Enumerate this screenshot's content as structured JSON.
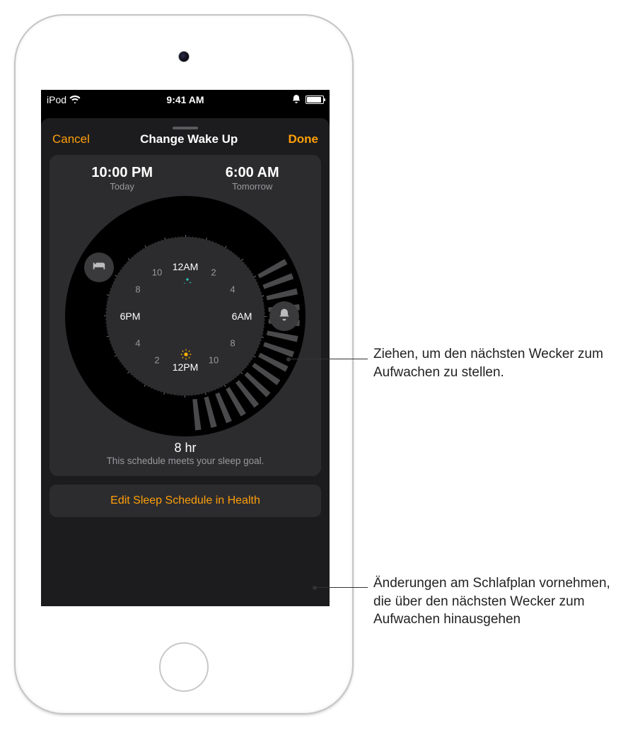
{
  "statusbar": {
    "carrier": "iPod",
    "time": "9:41 AM"
  },
  "sheet": {
    "cancel": "Cancel",
    "title": "Change Wake Up",
    "done": "Done"
  },
  "bedtime": {
    "time": "10:00 PM",
    "day": "Today"
  },
  "wake": {
    "time": "6:00 AM",
    "day": "Tomorrow"
  },
  "dial": {
    "labels": {
      "h0": "12AM",
      "h1": "2",
      "h2": "4",
      "h3": "6AM",
      "h4": "8",
      "h5": "10",
      "h6": "12PM",
      "h7": "2",
      "h8": "4",
      "h9": "6PM",
      "h10": "8",
      "h11": "10"
    }
  },
  "duration": {
    "value": "8 hr",
    "sub": "This schedule meets your sleep goal."
  },
  "edit_label": "Edit Sleep Schedule in Health",
  "callouts": {
    "wake": "Ziehen, um den nächsten Wecker zum Aufwachen zu stellen.",
    "edit": "Änderungen am Schlafplan vornehmen, die über den nächsten Wecker zum Aufwachen hinausgehen"
  },
  "colors": {
    "accent": "#ff9f0a"
  }
}
